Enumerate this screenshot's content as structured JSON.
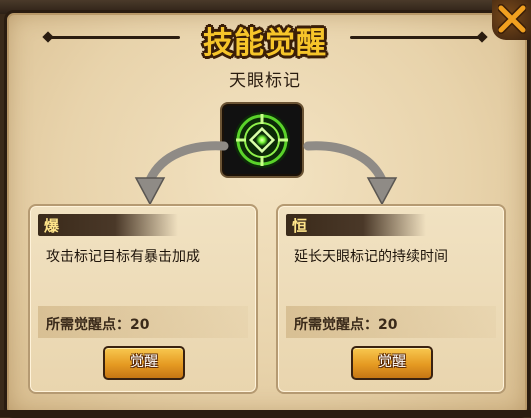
{
  "window": {
    "title": "技能觉醒"
  },
  "skill": {
    "name": "天眼标记",
    "icon": "eye-target-icon"
  },
  "options": [
    {
      "badge": "爆",
      "description": "攻击标记目标有暴击加成",
      "requirement": "所需觉醒点：20",
      "button_label": "觉醒"
    },
    {
      "badge": "恒",
      "description": "延长天眼标记的持续时间",
      "requirement": "所需觉醒点：20",
      "button_label": "觉醒"
    }
  ],
  "colors": {
    "title": "#f6c52a",
    "button": "#e59a22",
    "badge_text": "#ffe58a",
    "icon_glow": "#7dff3a"
  }
}
